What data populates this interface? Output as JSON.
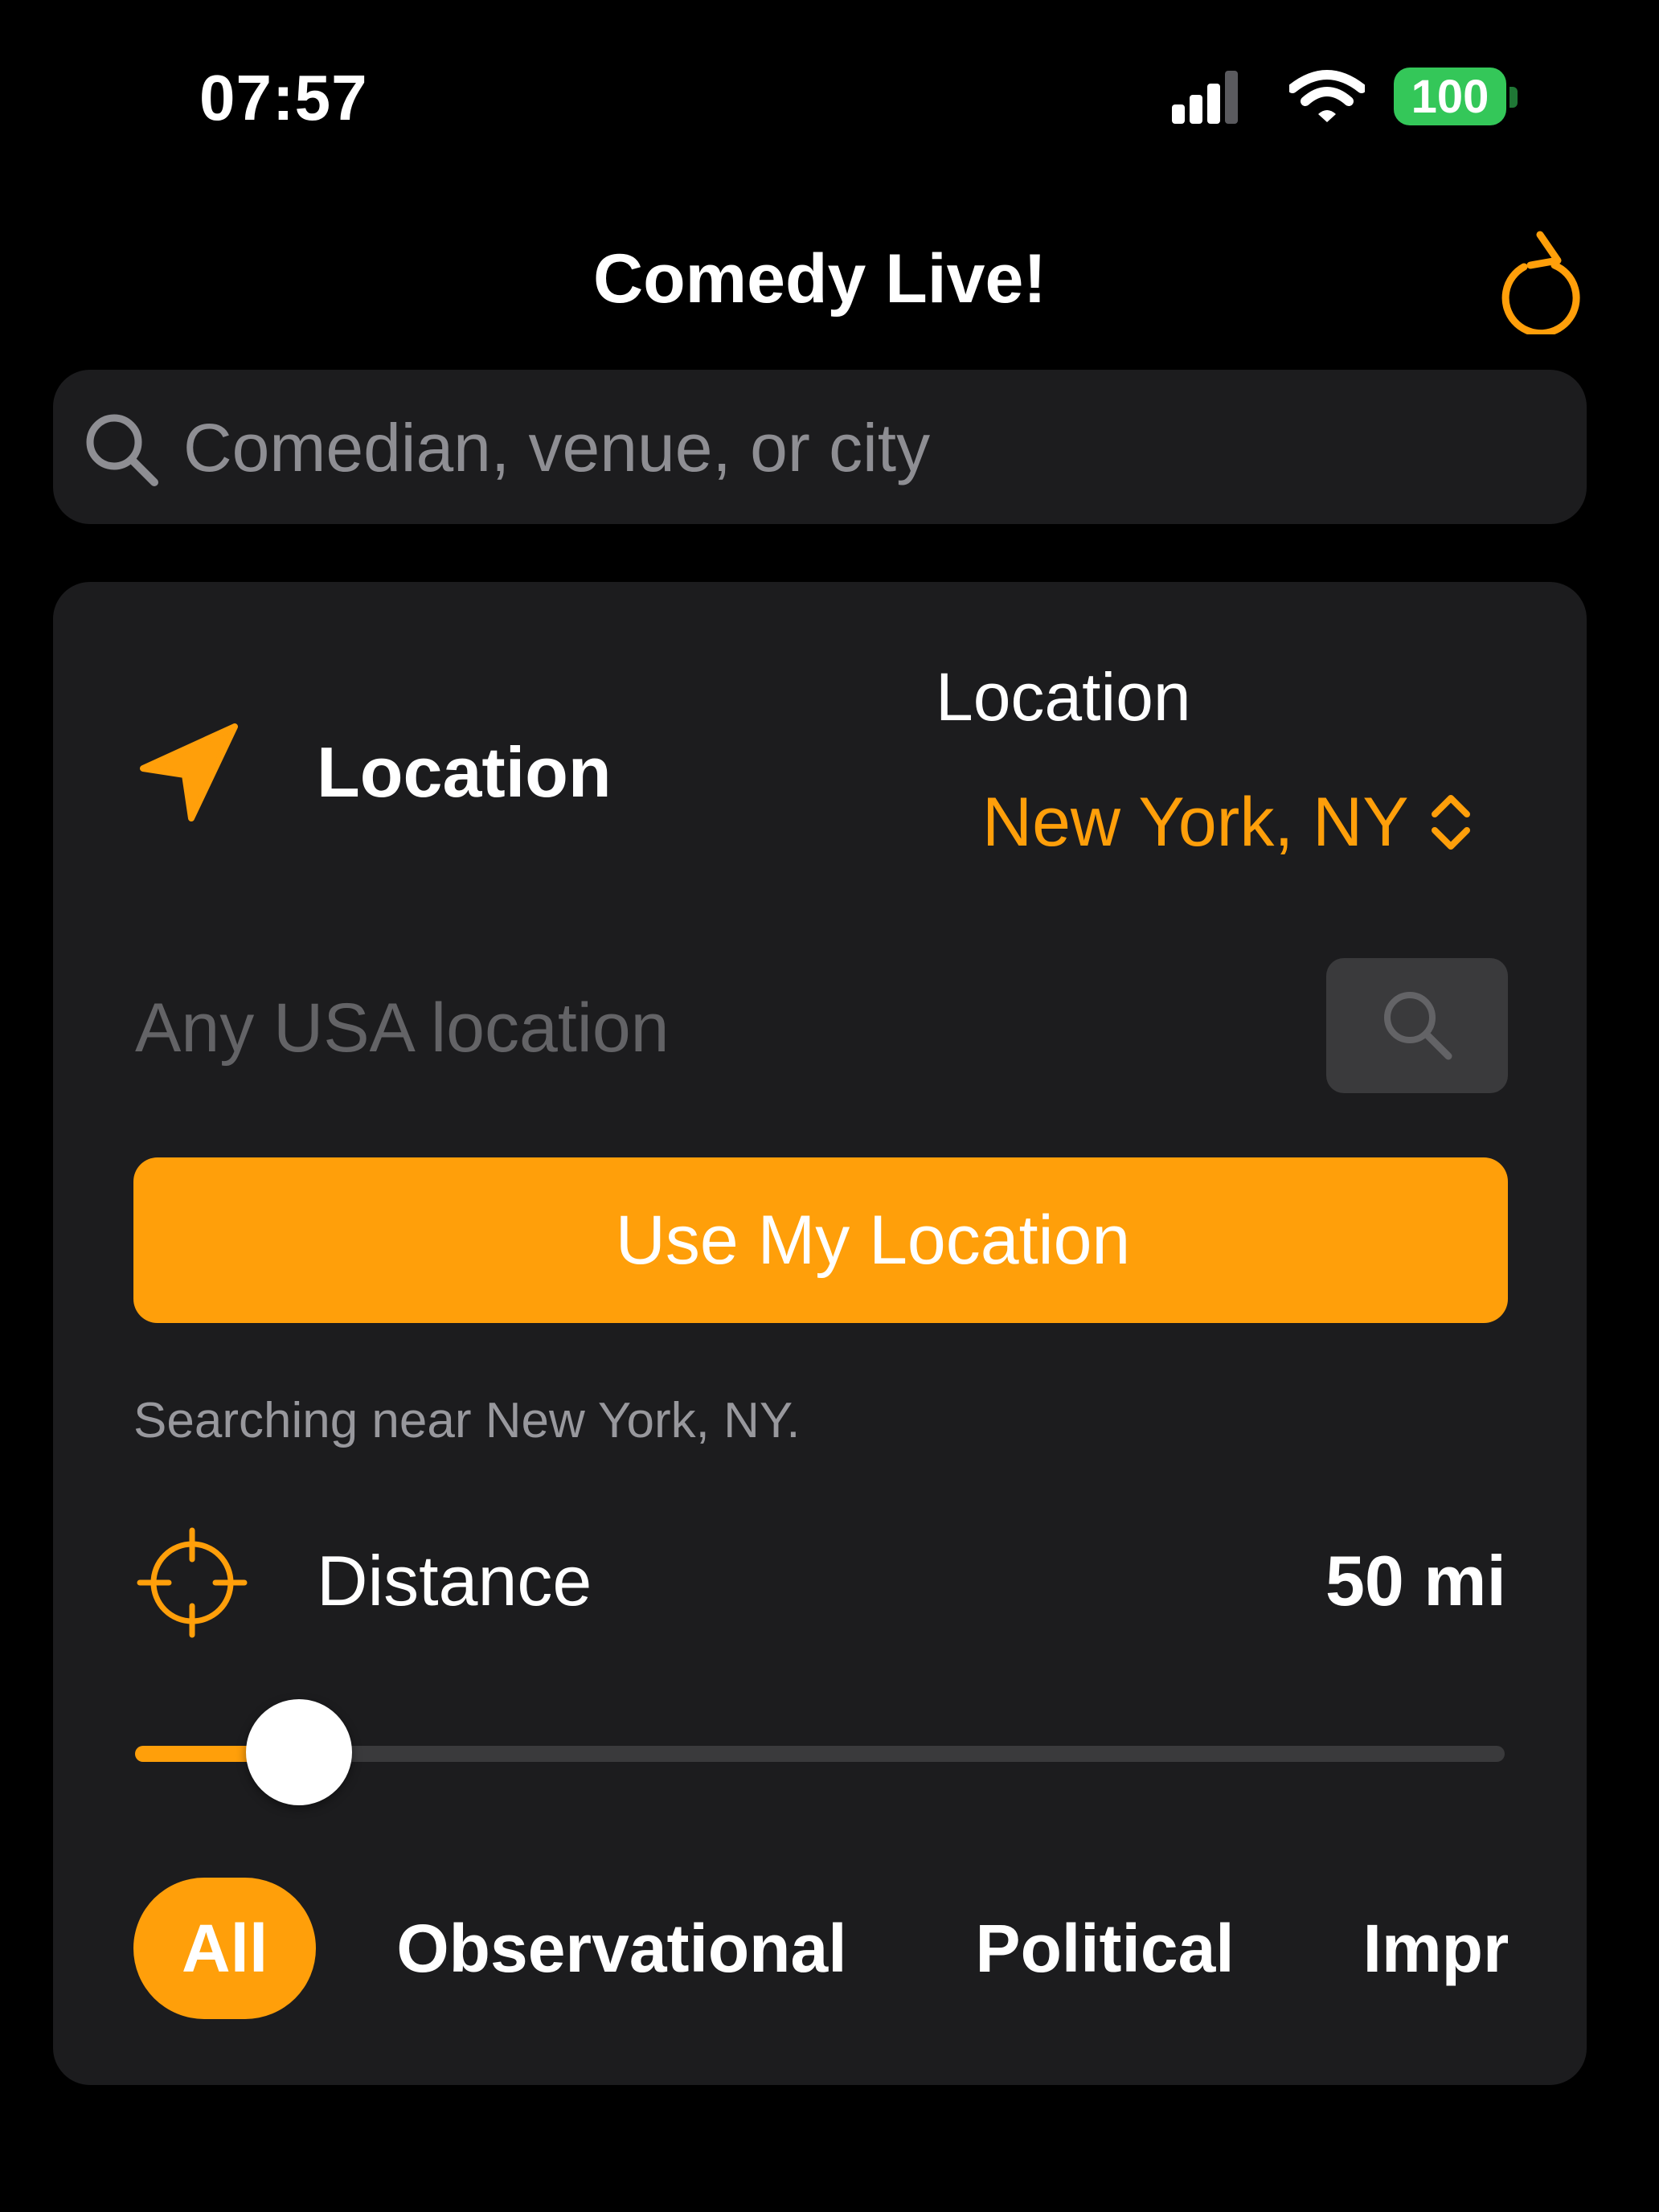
{
  "status_bar": {
    "time": "07:57",
    "battery": "100"
  },
  "nav": {
    "title": "Comedy Live!"
  },
  "search": {
    "placeholder": "Comedian, venue, or city"
  },
  "location": {
    "section_label": "Location",
    "picker_label": "Location",
    "picker_value": "New York, NY",
    "input_placeholder": "Any USA location",
    "use_my_location": "Use My Location",
    "status": "Searching near New York, NY."
  },
  "distance": {
    "label": "Distance",
    "value": "50 mi",
    "slider_fraction": 0.12
  },
  "categories": {
    "items": [
      "All",
      "Observational",
      "Political",
      "Improv"
    ],
    "selected": "All"
  },
  "colors": {
    "accent": "#ff9f0a",
    "background": "#000000",
    "card": "#1c1c1e",
    "battery": "#34c759"
  }
}
